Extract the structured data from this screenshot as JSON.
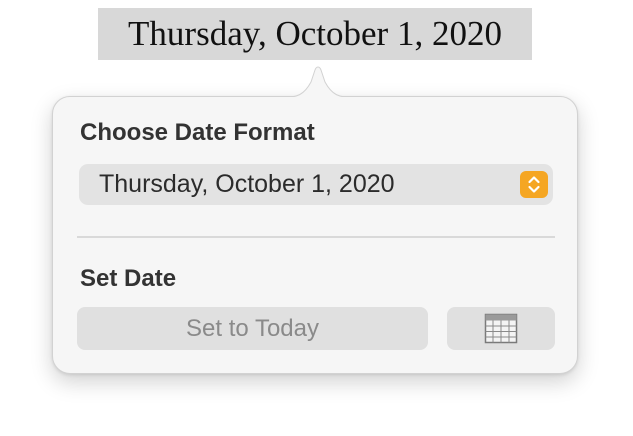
{
  "document": {
    "selected_date_text": "Thursday, October 1, 2020"
  },
  "popover": {
    "format_heading": "Choose Date Format",
    "format_value": "Thursday, October 1, 2020",
    "set_date_heading": "Set Date",
    "set_today_label": "Set to Today",
    "stepper_icon": "chevron-up-down-icon",
    "calendar_icon": "calendar-icon"
  },
  "colors": {
    "accent": "#f5a623",
    "popover_background": "#f6f6f6",
    "control_background": "#e3e3e3",
    "selection_highlight": "#d8d8d8"
  }
}
